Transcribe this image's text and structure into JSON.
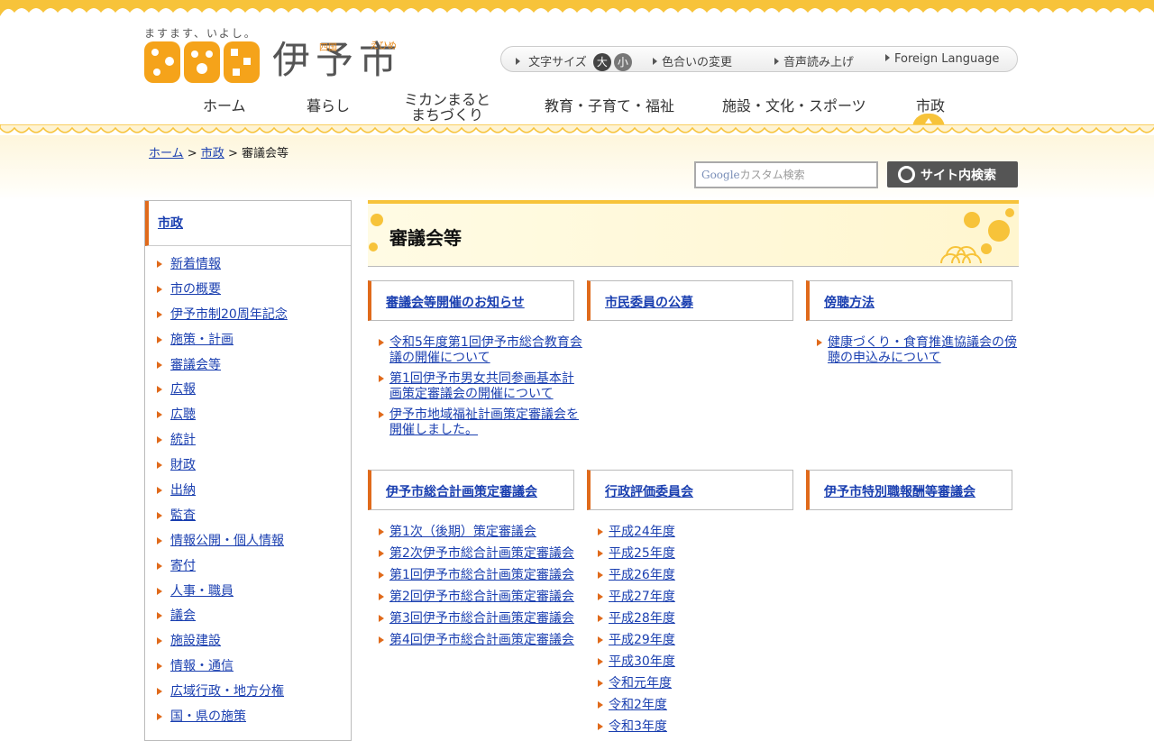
{
  "header": {
    "tagline": "ますます、いよし。",
    "city_name": "伊予市",
    "city_sub_left": "四国",
    "city_sub_right": "えひめ"
  },
  "utility": {
    "font_size_label": "文字サイズ",
    "font_large": "大",
    "font_small": "小",
    "color_change": "色合いの変更",
    "voice_reading": "音声読み上げ",
    "foreign_language": "Foreign Language"
  },
  "gnav": {
    "items": [
      {
        "label": "ホーム"
      },
      {
        "label": "暮らし"
      },
      {
        "label_line1": "ミカンまると",
        "label_line2": "まちづくり"
      },
      {
        "label": "教育・子育て・福祉"
      },
      {
        "label": "施設・文化・スポーツ"
      },
      {
        "label": "市政"
      }
    ]
  },
  "breadcrumb": {
    "home": "ホーム",
    "sep": " > ",
    "parent": "市政",
    "current": "審議会等"
  },
  "search": {
    "google": "Google",
    "placeholder": "カスタム検索",
    "button": "サイト内検索"
  },
  "sidebar": {
    "heading": "市政",
    "items": [
      "新着情報",
      "市の概要",
      "伊予市制20周年記念",
      "施策・計画",
      "審議会等",
      "広報",
      "広聴",
      "統計",
      "財政",
      "出納",
      "監査",
      "情報公開・個人情報",
      "寄付",
      "人事・職員",
      "議会",
      "施設建設",
      "情報・通信",
      "広域行政・地方分権",
      "国・県の施策"
    ]
  },
  "main": {
    "title": "審議会等",
    "sections": [
      {
        "heading": "審議会等開催のお知らせ",
        "links": [
          "令和5年度第1回伊予市総合教育会議の開催について",
          "第1回伊予市男女共同参画基本計画策定審議会の開催について",
          "伊予市地域福祉計画策定審議会を開催しました。"
        ]
      },
      {
        "heading": "市民委員の公募",
        "links": []
      },
      {
        "heading": "傍聴方法",
        "links": [
          "健康づくり・食育推進協議会の傍聴の申込みについて"
        ]
      },
      {
        "heading": "伊予市総合計画策定審議会",
        "links": [
          "第1次（後期）策定審議会",
          "第2次伊予市総合計画策定審議会",
          "第1回伊予市総合計画策定審議会",
          "第2回伊予市総合計画策定審議会",
          "第3回伊予市総合計画策定審議会",
          "第4回伊予市総合計画策定審議会"
        ]
      },
      {
        "heading": "行政評価委員会",
        "links": [
          "平成24年度",
          "平成25年度",
          "平成26年度",
          "平成27年度",
          "平成28年度",
          "平成29年度",
          "平成30年度",
          "令和元年度",
          "令和2年度",
          "令和3年度"
        ]
      },
      {
        "heading": "伊予市特別職報酬等審議会",
        "links": []
      }
    ]
  },
  "colors": {
    "accent": "#e06a1b",
    "yellow": "#f7c33a",
    "link": "#1a3fb0"
  }
}
